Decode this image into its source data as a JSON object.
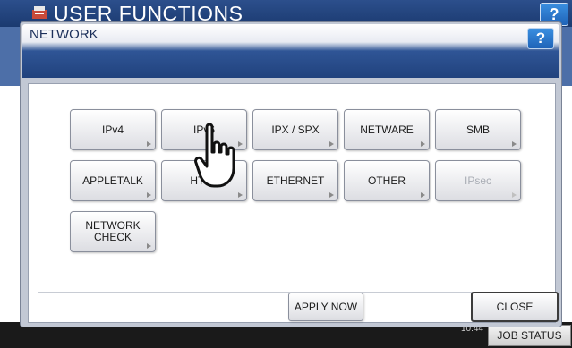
{
  "background": {
    "title": "USER FUNCTIONS",
    "help_label": "?",
    "date": "",
    "time": "10:44",
    "job_status_label": "JOB STATUS"
  },
  "dialog": {
    "title": "NETWORK",
    "help_label": "?",
    "buttons": [
      {
        "label": "IPv4",
        "enabled": true
      },
      {
        "label": "IPv6",
        "enabled": true
      },
      {
        "label": "IPX / SPX",
        "enabled": true
      },
      {
        "label": "NETWARE",
        "enabled": true
      },
      {
        "label": "SMB",
        "enabled": true
      },
      {
        "label": "APPLETALK",
        "enabled": true
      },
      {
        "label": "HTTP",
        "enabled": true
      },
      {
        "label": "ETHERNET",
        "enabled": true
      },
      {
        "label": "OTHER",
        "enabled": true
      },
      {
        "label": "IPsec",
        "enabled": false
      },
      {
        "label": "NETWORK\nCHECK",
        "enabled": true
      }
    ],
    "apply_label": "APPLY NOW",
    "close_label": "CLOSE"
  },
  "icons": [
    "user-functions-icon",
    "help-icon",
    "pointing-hand-icon",
    "arrow-right-icon"
  ],
  "colors": {
    "header_blue": "#21427d",
    "help_blue": "#1f63b8"
  }
}
